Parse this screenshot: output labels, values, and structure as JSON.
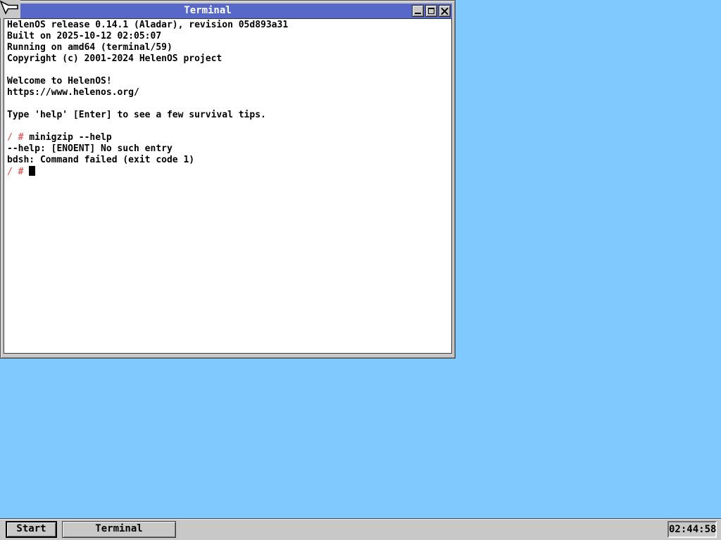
{
  "window": {
    "title": "Terminal",
    "controls": [
      {
        "name": "minimize-icon"
      },
      {
        "name": "maximize-icon"
      },
      {
        "name": "close-icon"
      }
    ]
  },
  "terminal": {
    "lines": [
      {
        "text": "HelenOS release 0.14.1 (Aladar), revision 05d893a31"
      },
      {
        "text": "Built on 2025-10-12 02:05:07"
      },
      {
        "text": "Running on amd64 (terminal/59)"
      },
      {
        "text": "Copyright (c) 2001-2024 HelenOS project"
      },
      {
        "text": ""
      },
      {
        "text": "Welcome to HelenOS!"
      },
      {
        "text": "https://www.helenos.org/"
      },
      {
        "text": ""
      },
      {
        "text": "Type 'help' [Enter] to see a few survival tips."
      },
      {
        "text": ""
      },
      {
        "prompt": "/ #",
        "text": " minigzip --help"
      },
      {
        "text": "--help: [ENOENT] No such entry"
      },
      {
        "text": "bdsh: Command failed (exit code 1)"
      },
      {
        "prompt": "/ #",
        "text": " ",
        "cursor": true
      }
    ]
  },
  "taskbar": {
    "start_label": "Start",
    "tasks": [
      {
        "label": "Terminal"
      }
    ],
    "clock": "02:44:58"
  },
  "pointer": {
    "name": "arrow-cursor"
  },
  "colors": {
    "desktop": "#80c9ff",
    "titlebar": "#5868c8",
    "chrome": "#c8c8c8",
    "terminal_bg": "#ffffff",
    "terminal_text": "#000000",
    "prompt": "#e86060",
    "title_text": "#ffffff"
  }
}
